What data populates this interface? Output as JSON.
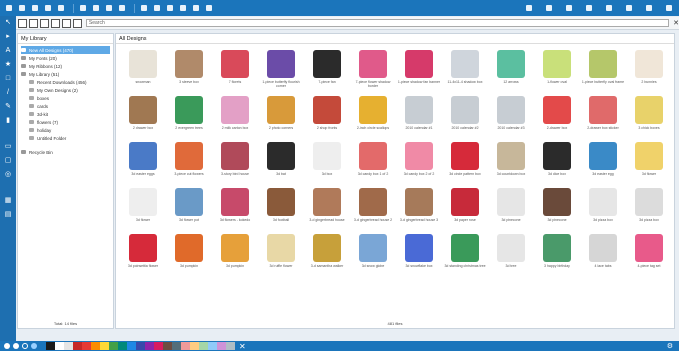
{
  "search": {
    "placeholder": "Search"
  },
  "library": {
    "title": "My Library",
    "tree": [
      {
        "label": "New All Designs (470)",
        "level": 0,
        "selected": true
      },
      {
        "label": "My Fonts (20)",
        "level": 0
      },
      {
        "label": "My Ribbons (12)",
        "level": 0
      },
      {
        "label": "My Library (51)",
        "level": 0
      },
      {
        "label": "Recent Downloads (456)",
        "level": 1
      },
      {
        "label": "My Own Designs (2)",
        "level": 1
      },
      {
        "label": "boxes",
        "level": 1
      },
      {
        "label": "cards",
        "level": 1
      },
      {
        "label": "3d-kit",
        "level": 1
      },
      {
        "label": "flowers (7)",
        "level": 1
      },
      {
        "label": "holiday",
        "level": 1
      },
      {
        "label": "Untitled Folder",
        "level": 1
      }
    ],
    "recycle": "Recycle Bin",
    "total": "Total: 14 files"
  },
  "main": {
    "title": "All Designs",
    "count": "481 files",
    "items": [
      {
        "caption": "snowman",
        "color": "#e8e3d8"
      },
      {
        "caption": "3 sleeve box",
        "color": "#b08a6a"
      },
      {
        "caption": "7 florets",
        "color": "#d94a5a"
      },
      {
        "caption": "1-piece butterfly flourish corner",
        "color": "#6b4ca8"
      },
      {
        "caption": "7-piece fan",
        "color": "#2b2b2b"
      },
      {
        "caption": "7-piece flower shadow border",
        "color": "#e05a8a"
      },
      {
        "caption": "1-piece shadow fan banner",
        "color": "#d63a6a"
      },
      {
        "caption": "11-4x11-4 shadow box",
        "color": "#cfd5dc"
      },
      {
        "caption": "12 arrows",
        "color": "#5bbfa0"
      },
      {
        "caption": "1-flower oval",
        "color": "#c9e07a"
      },
      {
        "caption": "1-piece butterfly oval frame",
        "color": "#b5c76a"
      },
      {
        "caption": "2 bunnies",
        "color": "#f0e6d8"
      },
      {
        "caption": "2 drawer box",
        "color": "#a07852"
      },
      {
        "caption": "2 evergreen trees",
        "color": "#3a9a5a"
      },
      {
        "caption": "2 milk carton box",
        "color": "#e3a0c6"
      },
      {
        "caption": "2 photo corners",
        "color": "#d89a3a"
      },
      {
        "caption": "2 shop fronts",
        "color": "#c44a3a"
      },
      {
        "caption": "2-inch circle scallops",
        "color": "#e6b030"
      },
      {
        "caption": "2010 calendar #1",
        "color": "#c7cdd3"
      },
      {
        "caption": "2010 calendar #2",
        "color": "#c7cdd3"
      },
      {
        "caption": "2010 calendar #3",
        "color": "#c7cdd3"
      },
      {
        "caption": "2-drawer box",
        "color": "#e34a4a"
      },
      {
        "caption": "2-drawer box sticker",
        "color": "#e06a6a"
      },
      {
        "caption": "3 chick boxes",
        "color": "#e8d26a"
      },
      {
        "caption": "3d easter eggs",
        "color": "#4a7ac7"
      },
      {
        "caption": "3-piece cut flowers",
        "color": "#e06a3a"
      },
      {
        "caption": "3-story bird house",
        "color": "#b04a5a"
      },
      {
        "caption": "3d bat",
        "color": "#2b2b2b"
      },
      {
        "caption": "3d box",
        "color": "#eeeeee"
      },
      {
        "caption": "3d candy box 1 of 2",
        "color": "#e36a6a"
      },
      {
        "caption": "3d candy box 2 of 2",
        "color": "#f08aa6"
      },
      {
        "caption": "3d circle pattern box",
        "color": "#d62a3a"
      },
      {
        "caption": "3d countdown box",
        "color": "#c7b79a"
      },
      {
        "caption": "3d dice box",
        "color": "#2b2b2b"
      },
      {
        "caption": "3d easter egg",
        "color": "#3a8ac7"
      },
      {
        "caption": "3d flower",
        "color": "#f0d26a"
      },
      {
        "caption": "3d flower",
        "color": "#eeeeee"
      },
      {
        "caption": "3d flower pot",
        "color": "#6a9ac7"
      },
      {
        "caption": "3d flowers - kokedo",
        "color": "#c74a6a"
      },
      {
        "caption": "3d football",
        "color": "#8a5a3a"
      },
      {
        "caption": "3-d gingerbread house",
        "color": "#b07a5a"
      },
      {
        "caption": "3-d gingerbread house 2",
        "color": "#a06a4a"
      },
      {
        "caption": "3-d gingerbread house 3",
        "color": "#a67a5a"
      },
      {
        "caption": "3d paper rose",
        "color": "#c72a3a"
      },
      {
        "caption": "3d pinecone",
        "color": "#e6e6e6"
      },
      {
        "caption": "3d pinecone",
        "color": "#6a4a3a"
      },
      {
        "caption": "3d pizza box",
        "color": "#e6e6e6"
      },
      {
        "caption": "3d pizza box",
        "color": "#dcdcdc"
      },
      {
        "caption": "3d poinsettia flower",
        "color": "#d62a3a"
      },
      {
        "caption": "3d pumpkin",
        "color": "#e06a2a"
      },
      {
        "caption": "3d pumpkin",
        "color": "#e6a03a"
      },
      {
        "caption": "3d ruffle flower",
        "color": "#e8d8a6"
      },
      {
        "caption": "3-d samantha walker",
        "color": "#c7a03a"
      },
      {
        "caption": "3d snow globe",
        "color": "#7aa6d6"
      },
      {
        "caption": "3d snowflake box",
        "color": "#4a6ad6"
      },
      {
        "caption": "3d standing christmas tree",
        "color": "#3a9a5a"
      },
      {
        "caption": "3d tree",
        "color": "#e6e6e6"
      },
      {
        "caption": "3 happy birthday",
        "color": "#4a9a6a"
      },
      {
        "caption": "4 lace tabs",
        "color": "#d6d6d6"
      },
      {
        "caption": "4-piece tag set",
        "color": "#e85a8a"
      }
    ]
  },
  "toolbar": {
    "colors": [
      "#1b1b1b",
      "#ffffff",
      "#e5e5e5",
      "#c62828",
      "#e53935",
      "#fb8c00",
      "#fdd835",
      "#43a047",
      "#00897b",
      "#1e88e5",
      "#3949ab",
      "#8e24aa",
      "#d81b60",
      "#6d4c41",
      "#546e7a",
      "#ef9a9a",
      "#ffcc80",
      "#a5d6a7",
      "#90caf9",
      "#ce93d8",
      "#b0bec5"
    ]
  }
}
